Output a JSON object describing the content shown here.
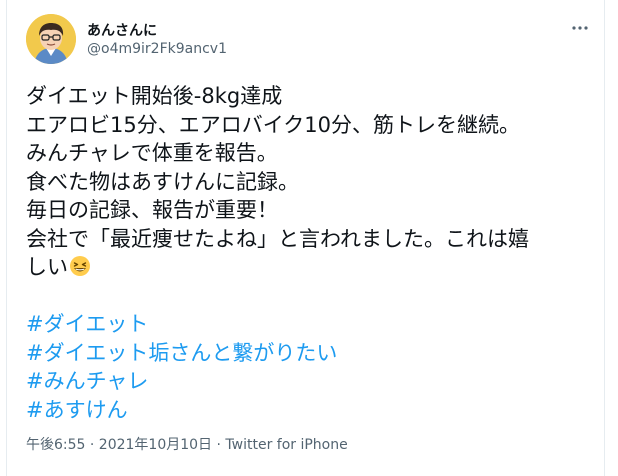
{
  "user": {
    "display_name": "あんさんに",
    "handle": "@o4m9ir2Fk9ancv1"
  },
  "more_icon": "more-horizontal-icon",
  "tweet": {
    "lines": [
      "ダイエット開始後-8kg達成",
      "エアロビ15分、エアロバイク10分、筋トレを継続。",
      "みんチャレで体重を報告。",
      "食べた物はあすけんに記録。",
      "毎日の記録、報告が重要！",
      "会社で「最近痩せたよね」と言われました。これは嬉",
      "しい"
    ],
    "emoji": "grinning-squinting-face-emoji",
    "hashtags": [
      "#ダイエット",
      "#ダイエット垢さんと繋がりたい",
      "#みんチャレ",
      "#あすけん"
    ]
  },
  "meta": {
    "timestamp": "午後6:55 · 2021年10月10日 · Twitter for iPhone"
  },
  "colors": {
    "link": "#1d9bf0",
    "secondary_text": "#536471",
    "primary_text": "#0f1419"
  }
}
